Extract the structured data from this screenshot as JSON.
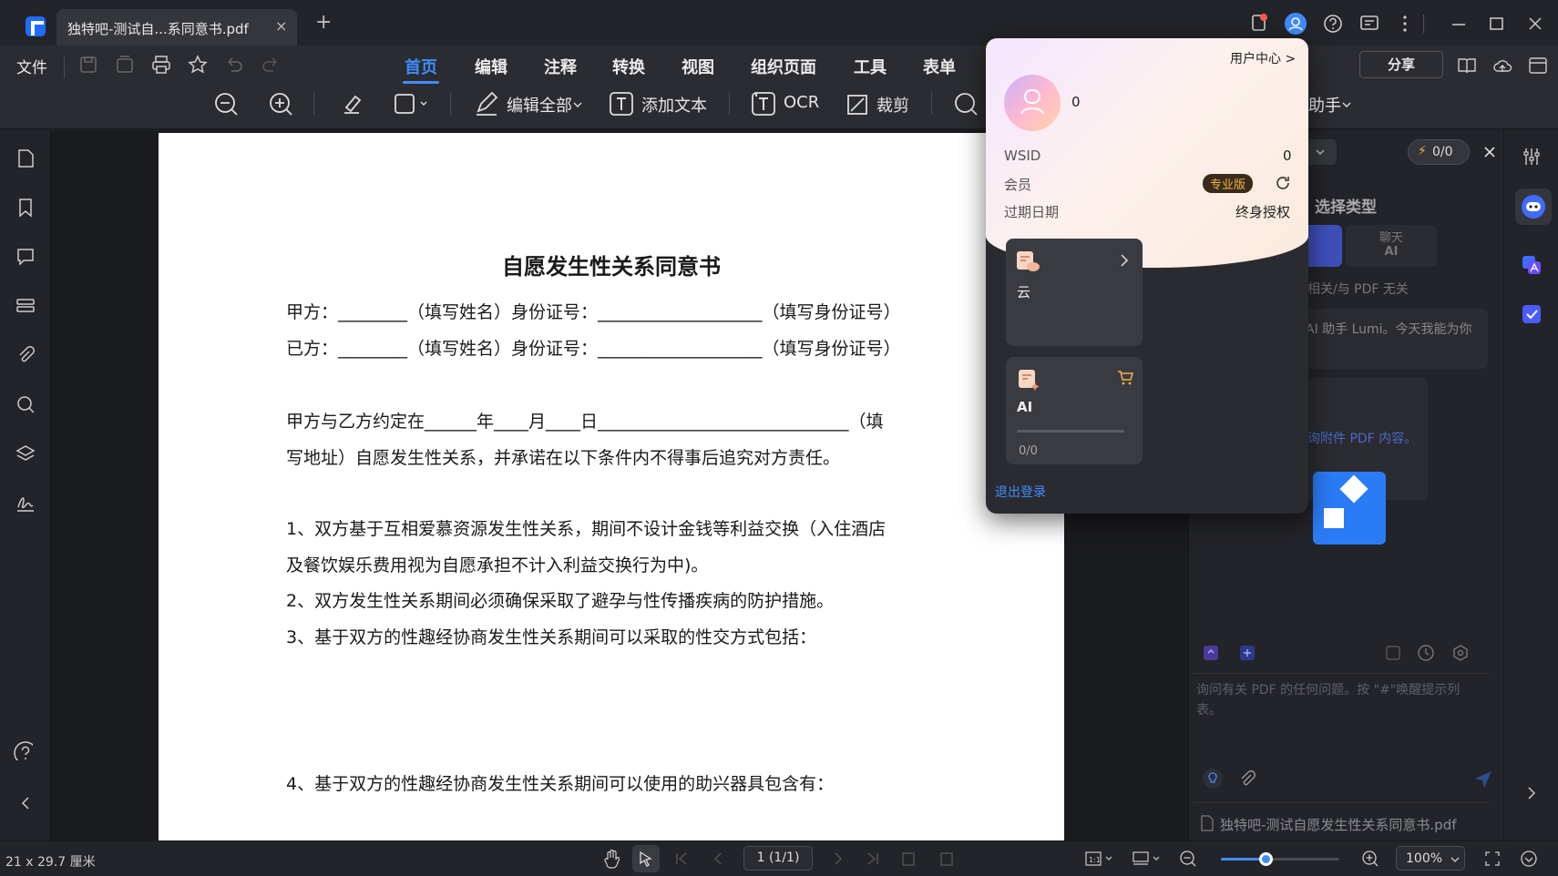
{
  "tabbar": {
    "tab_title": "独特吧-测试自...系同意书.pdf",
    "close": "×",
    "new_tab": "+"
  },
  "menu": {
    "file": "文件",
    "items": [
      "首页",
      "编辑",
      "注释",
      "转换",
      "视图",
      "组织页面",
      "工具",
      "表单"
    ],
    "share": "分享"
  },
  "tools": {
    "edit_all": "编辑全部",
    "add_text": "添加文本",
    "ocr": "OCR",
    "crop": "裁剪",
    "ai_assistant_partial": "助手"
  },
  "document": {
    "title": "自愿发生性关系同意书",
    "lines": [
      "甲方：________（填写姓名）身份证号：___________________（填写身份证号）",
      "已方：________（填写姓名）身份证号：___________________（填写身份证号）",
      "甲方与乙方约定在______年____月____日_____________________________（填",
      "写地址）自愿发生性关系，并承诺在以下条件内不得事后追究对方责任。",
      "1、双方基于互相爱慕资源发生性关系，期间不设计金钱等利益交换（入住酒店",
      "及餐饮娱乐费用视为自愿承担不计入利益交换行为中)。",
      "2、双方发生性关系期间必须确保采取了避孕与性传播疾病的防护措施。",
      "3、基于双方的性趣经协商发生性关系期间可以采取的性交方式包括：",
      "4、基于双方的性趣经协商发生性关系期间可以使用的助兴器具包含有："
    ]
  },
  "ai_panel": {
    "counter": "0/0",
    "select_type": "选择类型",
    "chat_label": "聊天",
    "ai_label": "AI",
    "unrelated": "相关/与 PDF 无关",
    "greeting": "AI 助手 Lumi。今天我能为你",
    "attach_hint": "询附件 PDF 内容。",
    "input_placeholder": "询问有关 PDF 的任何问题。按 \"#\"唤醒提示列表。",
    "file_name": "独特吧-测试自愿发生性关系同意书.pdf"
  },
  "popup": {
    "user_center": "用户中心 >",
    "username": "0",
    "wsid_label": "WSID",
    "wsid_value": "0",
    "member_label": "会员",
    "member_badge": "专业版",
    "expire_label": "过期日期",
    "expire_value": "终身授权",
    "cloud_label": "云",
    "ai_label": "AI",
    "ai_usage": "0/0",
    "ai_usage_fraction": 0,
    "logout": "退出登录"
  },
  "status": {
    "page_size": "21 x 29.7 厘米",
    "page_indicator": "1 (1/1)",
    "zoom": "100%",
    "zoom_fraction": 0.38
  },
  "colors": {
    "accent": "#3f8cff",
    "badge_bg": "#3a2b1a",
    "badge_fg": "#f2b24a"
  }
}
